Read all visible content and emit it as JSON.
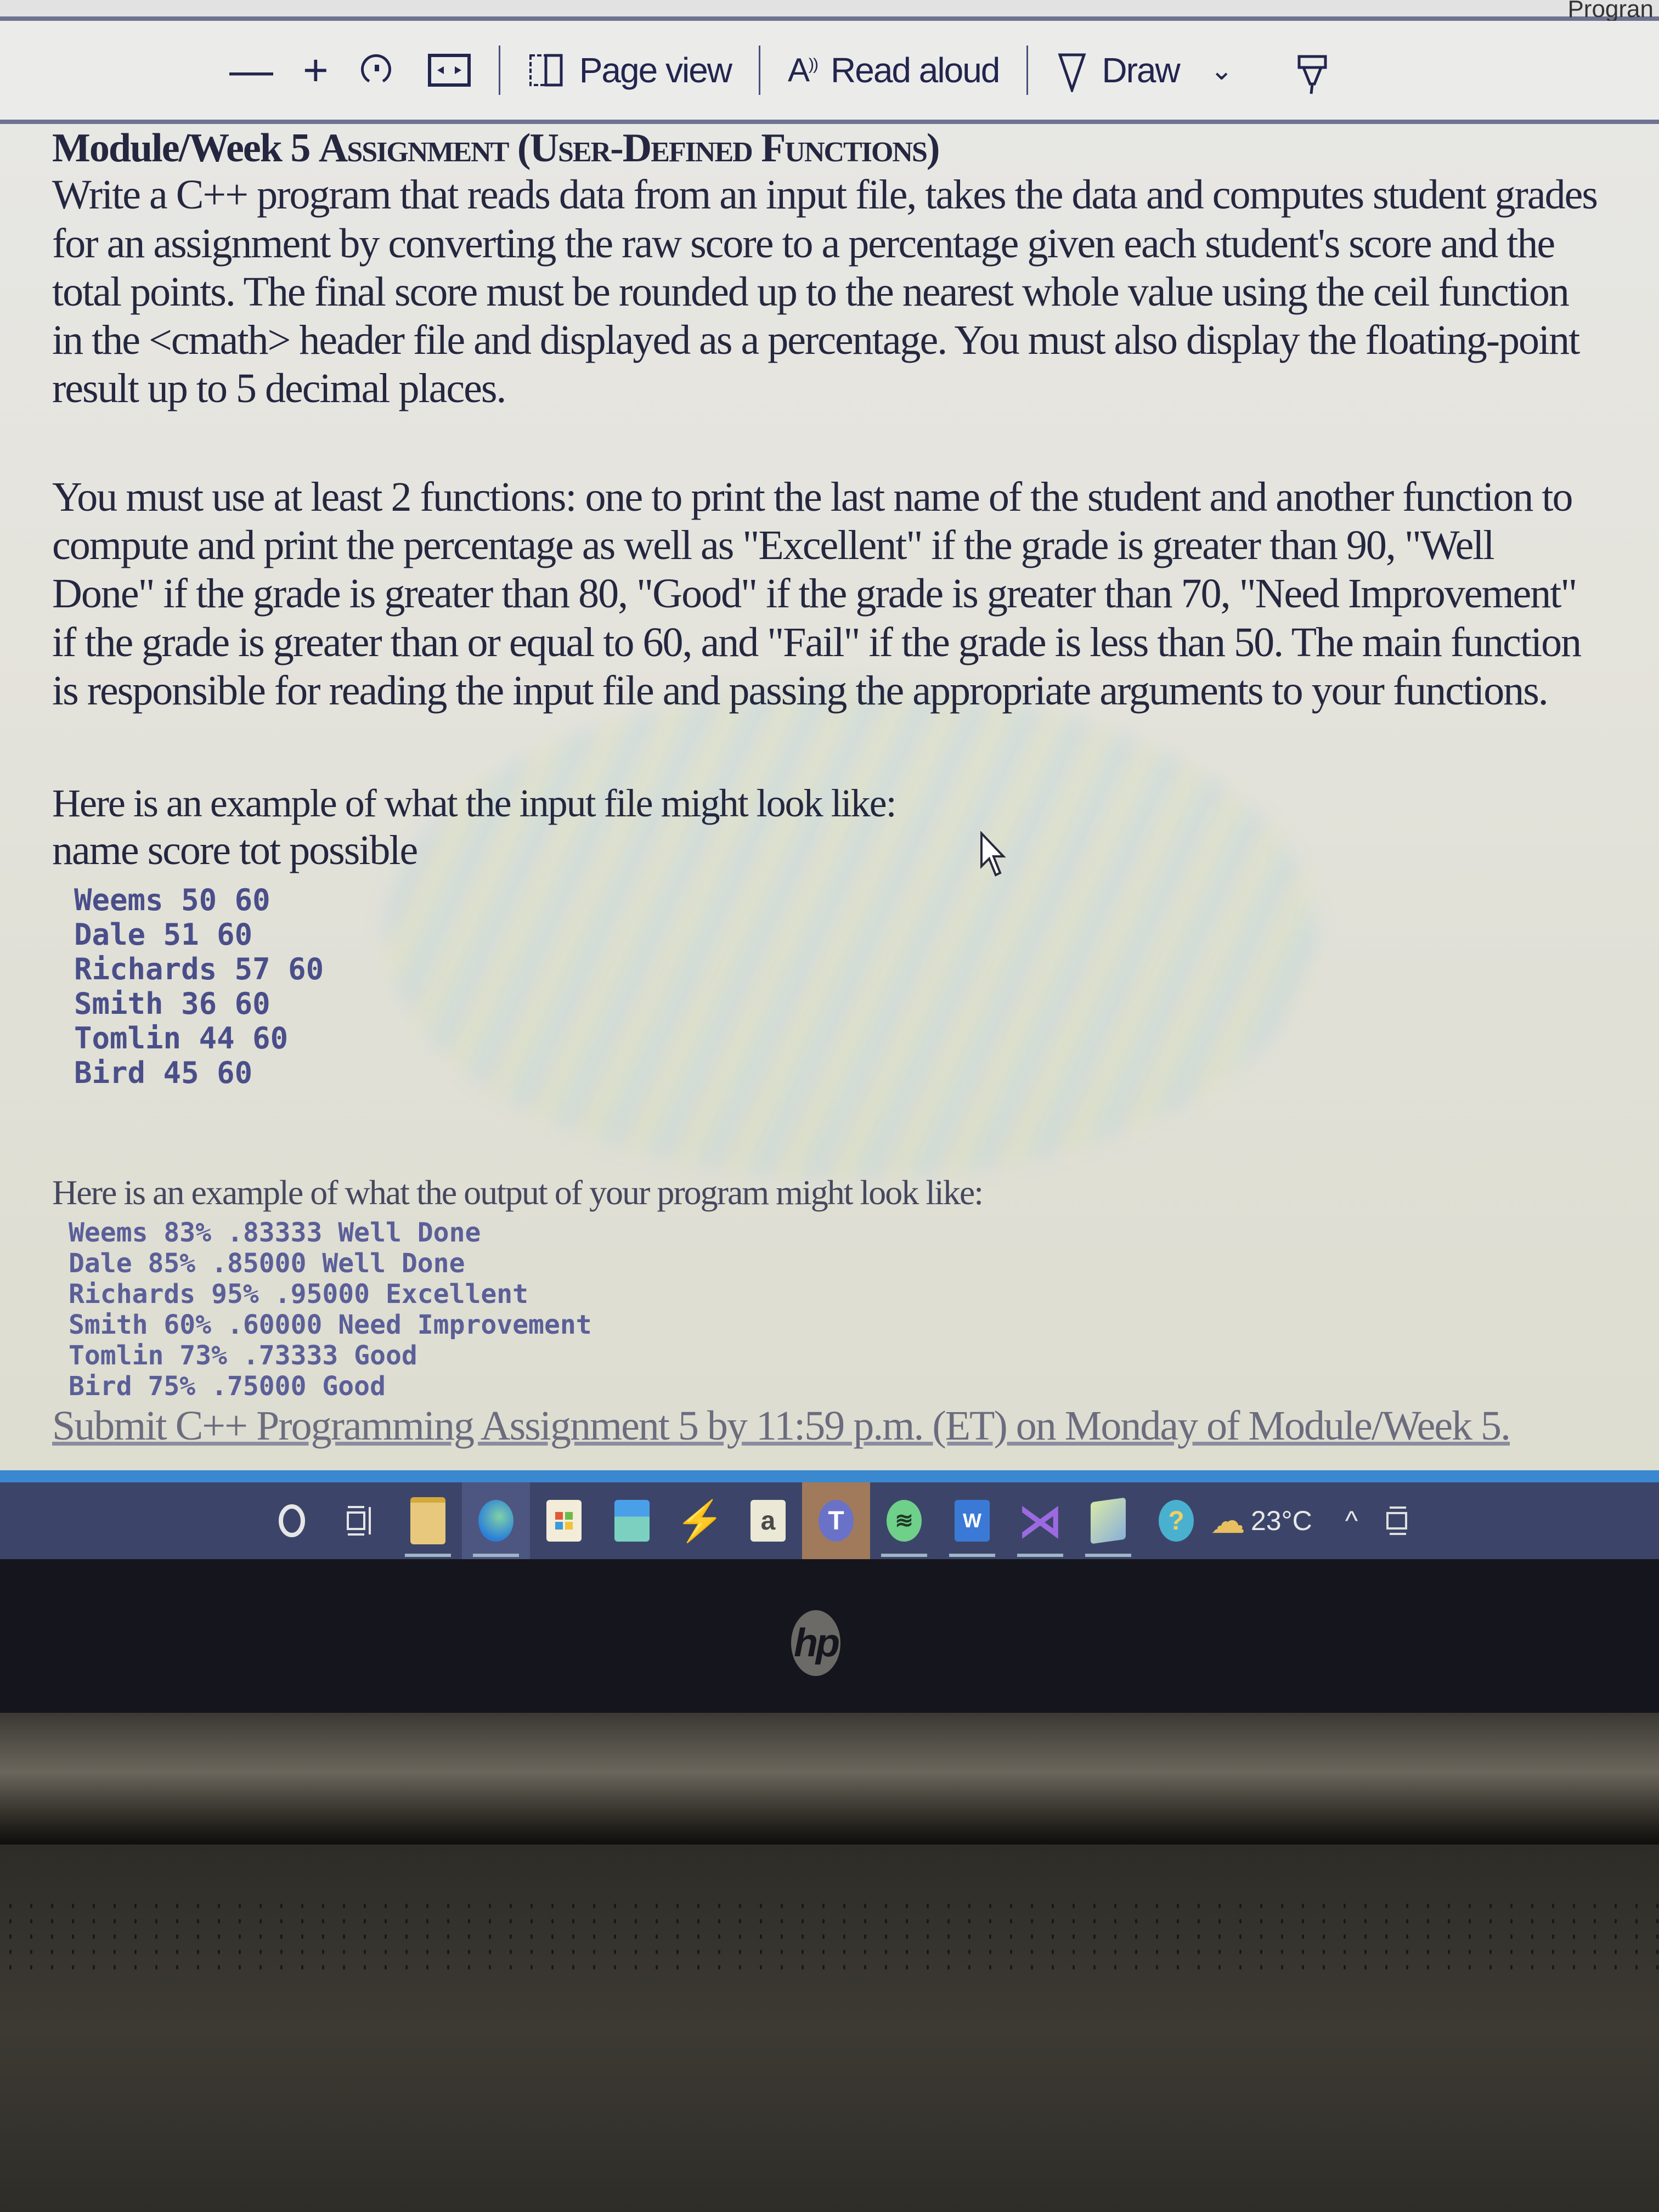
{
  "window": {
    "doc_name_fragment": "Progran"
  },
  "toolbar": {
    "zoom_out_icon": "minus-icon",
    "zoom_in_icon": "plus-icon",
    "rotate_icon": "rotate-icon",
    "fit_icon": "fit-width-icon",
    "page_view_label": "Page view",
    "read_aloud_label": "Read aloud",
    "draw_label": "Draw",
    "draw_chevron": "⌄",
    "highlight_icon": "highlighter-icon"
  },
  "document": {
    "title_prefix": "Module/Week 5 ",
    "title_main": "Assignment (User-Defined Functions)",
    "paragraph1": "Write a C++ program that reads data from an input file, takes the data and computes student grades for an assignment by converting the raw score to  a percentage given each student's score and the total points. The final score must be rounded up to the nearest whole value using the ceil function in the <cmath> header file and displayed as a percentage. You must also display the floating-point result up to 5 decimal places.",
    "paragraph2": "You must use at least 2 functions: one to print the last name of the student and another function to compute and print the percentage as well as \"Excellent\" if the grade is greater than 90, \"Well Done\" if the grade is greater than 80, \"Good\" if the grade is greater than 70, \"Need Improvement\" if the grade is greater than or equal to 60, and \"Fail\" if the grade is less than 50. The main function is responsible for reading the input file and passing the appropriate arguments to your functions.",
    "input_intro": "Here is an example of what the input file might look like:",
    "input_header": "name  score  tot possible",
    "input_rows": [
      "Weems 50 60",
      "Dale 51 60",
      "Richards 57 60",
      "Smith 36 60",
      "Tomlin 44 60",
      "Bird 45 60"
    ],
    "output_intro": "Here is an example of what the output of your program might look like:",
    "output_rows": [
      "Weems 83% .83333 Well Done",
      "Dale 85% .85000 Well Done",
      "Richards 95% .95000 Excellent",
      "Smith 60% .60000 Need Improvement",
      "Tomlin 73% .73333 Good",
      "Bird 75% .75000 Good"
    ],
    "submit_line": "Submit C++ Programming Assignment 5 by 11:59 p.m. (ET) on Monday of Module/Week 5."
  },
  "taskbar": {
    "items": [
      {
        "name": "cortana",
        "icon": "cortana-icon"
      },
      {
        "name": "task-view",
        "icon": "task-view-icon"
      },
      {
        "name": "file-explorer",
        "icon": "folder-icon"
      },
      {
        "name": "edge",
        "icon": "edge-icon"
      },
      {
        "name": "microsoft-store",
        "icon": "store-icon"
      },
      {
        "name": "mail",
        "icon": "mail-icon"
      },
      {
        "name": "zapier",
        "icon": "bolt-icon"
      },
      {
        "name": "amazon",
        "icon": "amazon-icon",
        "glyph": "a"
      },
      {
        "name": "teams",
        "icon": "teams-icon",
        "glyph": "T"
      },
      {
        "name": "spotify",
        "icon": "spotify-icon"
      },
      {
        "name": "word",
        "icon": "word-icon",
        "glyph": "W"
      },
      {
        "name": "visual-studio",
        "icon": "visual-studio-icon"
      },
      {
        "name": "notes",
        "icon": "notes-icon"
      },
      {
        "name": "help",
        "icon": "help-icon",
        "glyph": "?"
      }
    ],
    "weather_temp": "23°C",
    "tray_chevron": "^"
  },
  "device": {
    "logo": "hp"
  },
  "colors": {
    "toolbar_text": "#22254d",
    "doc_text": "#24273f",
    "mono_text": "#4a4f8a",
    "taskbar_bg": "#3c4569",
    "accent_blue": "#3a88d0"
  }
}
